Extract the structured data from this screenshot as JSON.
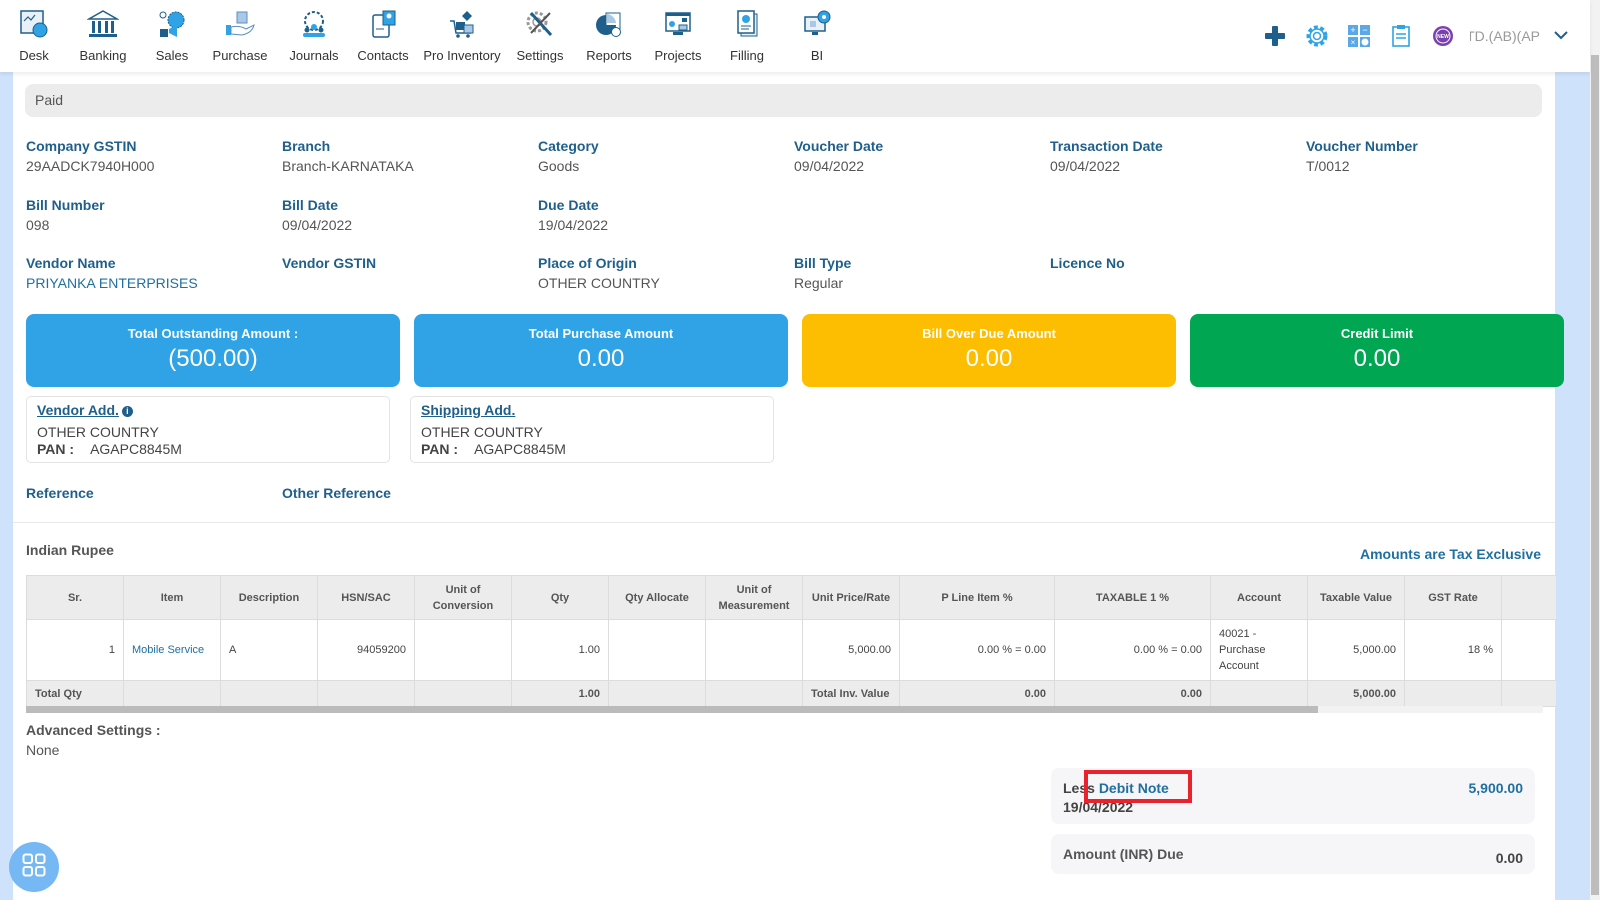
{
  "nav": {
    "items": [
      {
        "label": "Desk",
        "icon": "desk-icon"
      },
      {
        "label": "Banking",
        "icon": "bank-icon"
      },
      {
        "label": "Sales",
        "icon": "sales-icon"
      },
      {
        "label": "Purchase",
        "icon": "purchase-icon"
      },
      {
        "label": "Journals",
        "icon": "journals-icon"
      },
      {
        "label": "Contacts",
        "icon": "contacts-icon"
      },
      {
        "label": "Pro Inventory",
        "icon": "inventory-icon"
      },
      {
        "label": "Settings",
        "icon": "settings-icon"
      },
      {
        "label": "Reports",
        "icon": "reports-icon"
      },
      {
        "label": "Projects",
        "icon": "projects-icon"
      },
      {
        "label": "Filling",
        "icon": "filling-icon"
      },
      {
        "label": "BI",
        "icon": "bi-icon"
      }
    ],
    "company": "TD.(AB)(AP",
    "tools": [
      "add-icon",
      "gear-icon",
      "calculator-icon",
      "clipboard-icon",
      "new-badge-icon"
    ]
  },
  "status": "Paid",
  "fields": {
    "company_gstin": {
      "label": "Company GSTIN",
      "value": "29AADCK7940H000"
    },
    "branch": {
      "label": "Branch",
      "value": "Branch-KARNATAKA"
    },
    "category": {
      "label": "Category",
      "value": "Goods"
    },
    "voucher_date": {
      "label": "Voucher Date",
      "value": "09/04/2022"
    },
    "transaction_date": {
      "label": "Transaction Date",
      "value": "09/04/2022"
    },
    "voucher_number": {
      "label": "Voucher Number",
      "value": "T/0012"
    },
    "bill_number": {
      "label": "Bill Number",
      "value": "098"
    },
    "bill_date": {
      "label": "Bill Date",
      "value": "09/04/2022"
    },
    "due_date": {
      "label": "Due Date",
      "value": "19/04/2022"
    },
    "vendor_name": {
      "label": "Vendor Name",
      "value": "PRIYANKA ENTERPRISES"
    },
    "vendor_gstin": {
      "label": "Vendor GSTIN",
      "value": ""
    },
    "place_of_origin": {
      "label": "Place of Origin",
      "value": "OTHER COUNTRY"
    },
    "bill_type": {
      "label": "Bill Type",
      "value": "Regular"
    },
    "licence_no": {
      "label": "Licence No",
      "value": ""
    }
  },
  "cards": [
    {
      "title": "Total Outstanding Amount :",
      "value": "(500.00)",
      "color": "#2fa3e6"
    },
    {
      "title": "Total Purchase Amount",
      "value": "0.00",
      "color": "#2fa3e6"
    },
    {
      "title": "Bill Over Due Amount",
      "value": "0.00",
      "color": "#fdbd00"
    },
    {
      "title": "Credit Limit",
      "value": "0.00",
      "color": "#00a651"
    }
  ],
  "addresses": {
    "vendor": {
      "title": "Vendor Add.",
      "line": "OTHER COUNTRY",
      "pan_label": "PAN :",
      "pan": "AGAPC8845M"
    },
    "shipping": {
      "title": "Shipping Add.",
      "line": "OTHER COUNTRY",
      "pan_label": "PAN :",
      "pan": "AGAPC8845M"
    }
  },
  "references": {
    "reference": "Reference",
    "other_reference": "Other Reference"
  },
  "currency": "Indian Rupee",
  "tax_note": "Amounts are Tax Exclusive",
  "table": {
    "headers": [
      "Sr.",
      "Item",
      "Description",
      "HSN/SAC",
      "Unit of Conversion",
      "Qty",
      "Qty Allocate",
      "Unit of Measurement",
      "Unit Price/Rate",
      "P Line Item %",
      "TAXABLE 1 %",
      "Account",
      "Taxable Value",
      "GST Rate",
      ""
    ],
    "rows": [
      {
        "sr": "1",
        "item": "Mobile Service",
        "description": "A",
        "hsn": "94059200",
        "unit_conversion": "",
        "qty": "1.00",
        "qty_allocate": "",
        "uom": "",
        "unit_price": "5,000.00",
        "p_line": "0.00 % = 0.00",
        "taxable1": "0.00 % = 0.00",
        "account": "40021 - Purchase Account",
        "taxable_value": "5,000.00",
        "gst_rate": "18 %"
      }
    ],
    "totals": {
      "label": "Total Qty",
      "qty": "1.00",
      "inv_label": "Total Inv. Value",
      "p_line": "0.00",
      "taxable1": "0.00",
      "taxable_value": "5,000.00"
    }
  },
  "advanced": {
    "label": "Advanced Settings :",
    "value": "None"
  },
  "summary": {
    "debit_prefix": "Less",
    "debit_link": "Debit Note",
    "debit_date": "19/04/2022",
    "debit_amount": "5,900.00",
    "due_label": "Amount (INR) Due",
    "due_amount": "0.00"
  }
}
